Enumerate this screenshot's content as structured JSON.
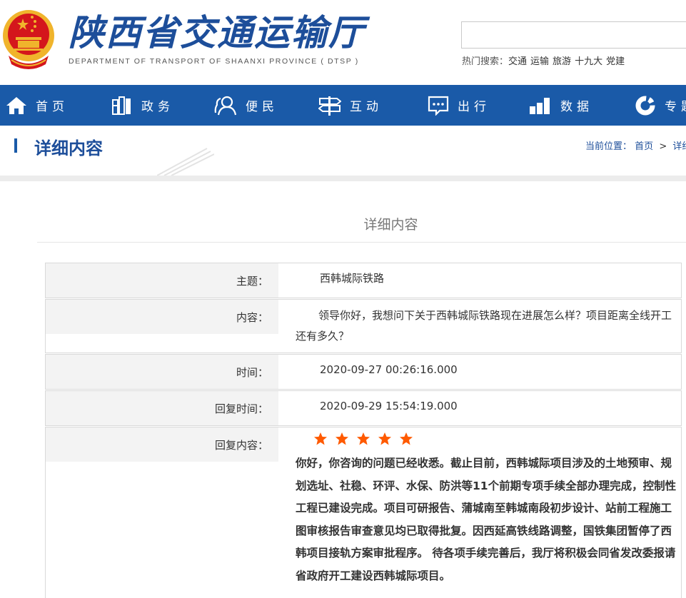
{
  "header": {
    "site_title": "陕西省交通运输厅",
    "site_subtitle": "DEPARTMENT OF TRANSPORT OF SHAANXI PROVINCE ( DTSP )",
    "search_placeholder": "",
    "hot_search_label": "热门搜索：",
    "hot_keywords": [
      "交通",
      "运输",
      "旅游",
      "十九大",
      "党建"
    ]
  },
  "nav": {
    "items": [
      {
        "label": "首页",
        "icon": "home-icon"
      },
      {
        "label": "政务",
        "icon": "books-icon"
      },
      {
        "label": "便民",
        "icon": "people-icon"
      },
      {
        "label": "互动",
        "icon": "signpost-icon"
      },
      {
        "label": "出行",
        "icon": "chat-screen-icon"
      },
      {
        "label": "数据",
        "icon": "bar-chart-icon"
      },
      {
        "label": "专题",
        "icon": "donut-icon"
      }
    ]
  },
  "banner": {
    "title": "详细内容",
    "breadcrumb_label": "当前位置：",
    "breadcrumb_home": "首页",
    "breadcrumb_sep": ">",
    "breadcrumb_current": "详细内容"
  },
  "content": {
    "title": "详细内容",
    "subject_label": "主题：",
    "subject_value": "西韩城际铁路",
    "body_label": "内容：",
    "body_value": "领导你好，我想问下关于西韩城际铁路现在进展怎么样？项目距离全线开工还有多久？",
    "time_label": "时间：",
    "time_value": "2020-09-27 00:26:16.000",
    "reply_time_label": "回复时间：",
    "reply_time_value": "2020-09-29 15:54:19.000",
    "reply_label": "回复内容：",
    "rating": 5,
    "star_color": "#ff5a00",
    "reply_value": "你好，你咨询的问题已经收悉。截止目前，西韩城际项目涉及的土地预审、规划选址、社稳、环评、水保、防洪等11个前期专项手续全部办理完成，控制性工程已建设完成。项目可研报告、蒲城南至韩城南段初步设计、站前工程施工图审核报告审查意见均已取得批复。因西延高铁线路调整，国铁集团暂停了西韩项目接轨方案审批程序。 待各项手续完善后，我厅将积极会同省发改委报请省政府开工建设西韩城际项目。"
  },
  "colors": {
    "brand_blue": "#1a5aa8",
    "title_blue": "#1d4e9a",
    "label_bg": "#f3f3f3",
    "emblem_red": "#d4161c",
    "emblem_gold": "#f0b42c"
  }
}
